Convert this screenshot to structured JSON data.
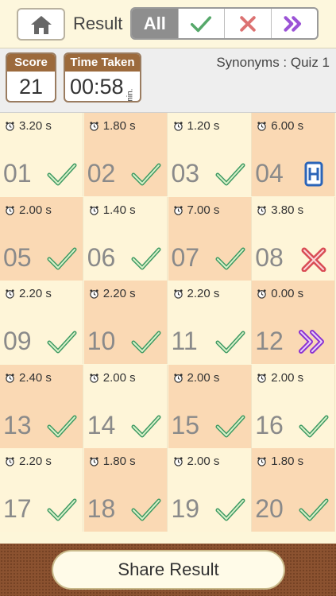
{
  "header": {
    "result_label": "Result",
    "filter_all": "All"
  },
  "info": {
    "score_label": "Score",
    "score_value": "21",
    "time_label": "Time Taken",
    "time_value": "00:58",
    "time_unit": "min.",
    "quiz_title": "Synonyms : Quiz 1"
  },
  "questions": [
    {
      "num": "01",
      "time": "3.20 s",
      "status": "correct"
    },
    {
      "num": "02",
      "time": "1.80 s",
      "status": "correct"
    },
    {
      "num": "03",
      "time": "1.20 s",
      "status": "correct"
    },
    {
      "num": "04",
      "time": "6.00 s",
      "status": "hint"
    },
    {
      "num": "05",
      "time": "2.00 s",
      "status": "correct"
    },
    {
      "num": "06",
      "time": "1.40 s",
      "status": "correct"
    },
    {
      "num": "07",
      "time": "7.00 s",
      "status": "correct"
    },
    {
      "num": "08",
      "time": "3.80 s",
      "status": "wrong"
    },
    {
      "num": "09",
      "time": "2.20 s",
      "status": "correct"
    },
    {
      "num": "10",
      "time": "2.20 s",
      "status": "correct"
    },
    {
      "num": "11",
      "time": "2.20 s",
      "status": "correct"
    },
    {
      "num": "12",
      "time": "0.00 s",
      "status": "skipped"
    },
    {
      "num": "13",
      "time": "2.40 s",
      "status": "correct"
    },
    {
      "num": "14",
      "time": "2.00 s",
      "status": "correct"
    },
    {
      "num": "15",
      "time": "2.00 s",
      "status": "correct"
    },
    {
      "num": "16",
      "time": "2.00 s",
      "status": "correct"
    },
    {
      "num": "17",
      "time": "2.20 s",
      "status": "correct"
    },
    {
      "num": "18",
      "time": "1.80 s",
      "status": "correct"
    },
    {
      "num": "19",
      "time": "2.00 s",
      "status": "correct"
    },
    {
      "num": "20",
      "time": "1.80 s",
      "status": "correct"
    }
  ],
  "footer": {
    "share_label": "Share Result"
  }
}
